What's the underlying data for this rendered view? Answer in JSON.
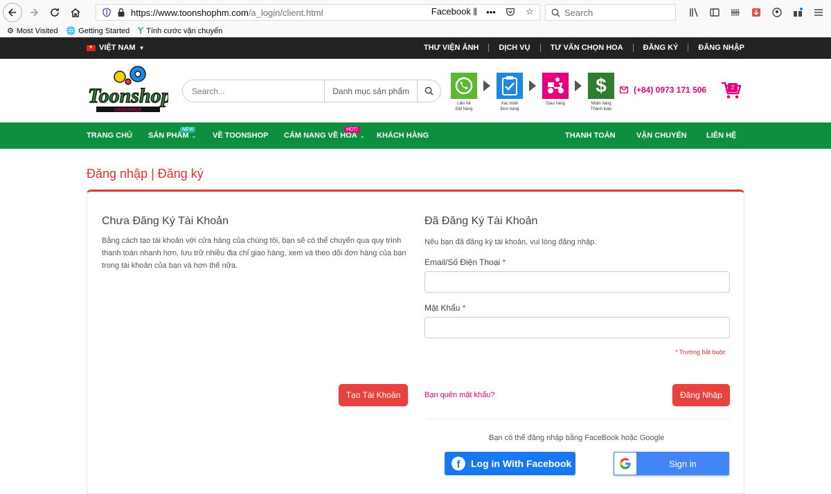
{
  "browser": {
    "url_host": "https://www.toonshophm.com",
    "url_path": "/a_login/client.html",
    "url_right_label": "Facebook",
    "search_placeholder": "Search",
    "bookmarks": [
      "Most Visited",
      "Getting Started",
      "Tính cước vận chuyển"
    ]
  },
  "topbar": {
    "language": "VIỆT NAM",
    "links": [
      "THƯ VIỆN ẢNH",
      "DỊCH VỤ",
      "TƯ VẤN CHỌN HOA",
      "ĐĂNG KÝ",
      "ĐĂNG NHẬP"
    ]
  },
  "header": {
    "search_placeholder": "Search...",
    "category_label": "Danh mục sản phẩm",
    "steps": [
      {
        "icon": "whatsapp-icon",
        "color": "#5cb833",
        "caption1": "Liên hệ",
        "caption2": "Đặt hàng"
      },
      {
        "icon": "clipboard-check-icon",
        "color": "#1e88e5",
        "caption1": "Xác minh",
        "caption2": "Đơn hàng"
      },
      {
        "icon": "delivery-scooter-icon",
        "color": "#e5007e",
        "caption1": "Giao hàng",
        "caption2": ""
      },
      {
        "icon": "dollar-icon",
        "color": "#2e7d32",
        "caption1": "Nhận hàng",
        "caption2": "Thanh toán"
      }
    ],
    "phone": "(+84) 0973 171 506",
    "cart_count": "2"
  },
  "nav": {
    "home": "TRANG CHỦ",
    "products": "SẢN PHẨM",
    "products_tag": "NEW",
    "about": "VỀ TOONSHOP",
    "guide": "CẨM NANG VỀ HOA",
    "guide_tag": "HOT!",
    "customers": "KHÁCH HÀNG",
    "payment": "THANH TOÁN",
    "shipping": "VẬN CHUYỂN",
    "contact": "LIÊN HỆ"
  },
  "page": {
    "title": "Đăng nhập | Đăng ký",
    "left": {
      "heading": "Chưa Đăng Ký Tài Khoản",
      "text": "Bằng cách tạo tài khoản với cửa hàng của chúng tôi, bạn sẽ có thể chuyển qua quy trình thanh toán nhanh hơn, lưu trữ nhiều địa chỉ giao hàng, xem và theo dõi đơn hàng của bạn trong tài khoản của bạn và hơn thế nữa.",
      "create_button": "Tạo Tài Khoản"
    },
    "right": {
      "heading": "Đã Đăng Ký Tài Khoản",
      "text": "Nếu bạn đã đăng ký tài khoản, vui lòng đăng nhập.",
      "email_label": "Email/Số Điện Thoại",
      "password_label": "Mật Khẩu",
      "required_mark": "*",
      "required_note": "* Trường bắt buộc",
      "forgot_link": "Bạn quên mật khẩu?",
      "login_button": "Đăng Nhập",
      "social_text": "Bạn có thể đăng nhập bằng FaceBook hoặc Google",
      "facebook_button": "Log in With Facebook",
      "google_button": "Sign in"
    }
  },
  "colors": {
    "accent_red": "#e3312e",
    "green_nav": "#0c8f3e",
    "pink": "#e5007e",
    "facebook_blue": "#1877f2",
    "google_blue": "#4285f4"
  }
}
